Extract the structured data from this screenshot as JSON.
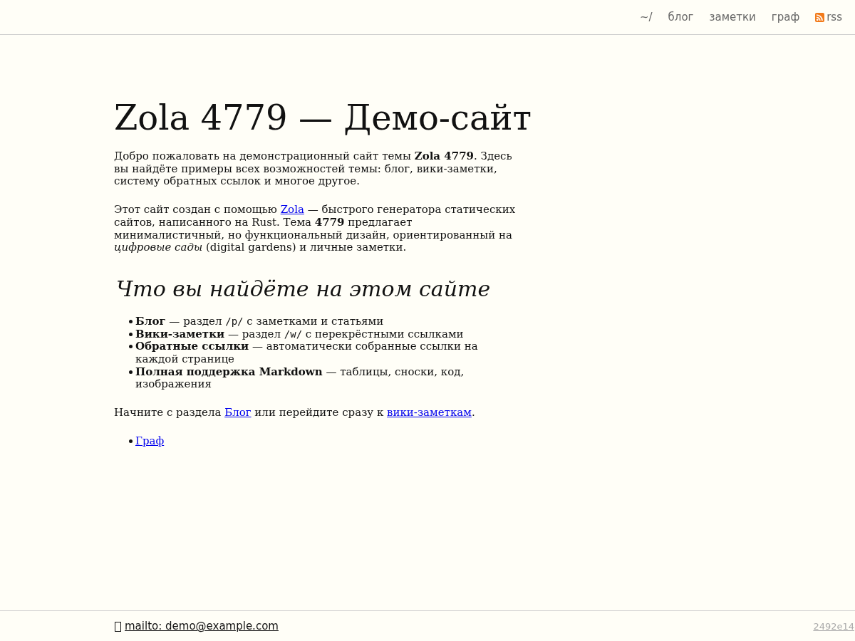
{
  "nav": [
    {
      "label": "~/",
      "kind": "page"
    },
    {
      "label": "блог",
      "kind": "page"
    },
    {
      "label": "заметки",
      "kind": "page"
    },
    {
      "label": "граф",
      "kind": "page"
    },
    {
      "label": "rss",
      "kind": "feed"
    }
  ],
  "title": "Zola 4779 — Демо-сайт",
  "content": [
    {
      "kind": "paragraph",
      "segments": [
        {
          "kind": "text",
          "text": "Добро пожаловать на демонстрационный сайт темы **Zola 4779**. Здесь вы найдёте примеры всех возможностей темы: блог, вики-заметки, систему обратных ссылок и многое другое."
        }
      ]
    },
    {
      "kind": "paragraph",
      "segments": [
        {
          "kind": "text",
          "text": "Этот сайт создан с помощью "
        },
        {
          "kind": "link",
          "text": "Zola"
        },
        {
          "kind": "text",
          "text": " — быстрого генератора статических сайтов, написанного на Rust. Тема **4779** предлагает минималистичный, но функциональный дизайн, ориентированный на *цифровые сады* (digital gardens) и личные заметки."
        }
      ]
    },
    {
      "kind": "heading",
      "text": "Что вы найдёте на этом сайте"
    },
    {
      "kind": "list",
      "items": [
        {
          "segments": [
            {
              "kind": "text",
              "text": "**Блог** — раздел "
            },
            {
              "kind": "code",
              "text": "/p/"
            },
            {
              "kind": "text",
              "text": " с заметками и статьями"
            }
          ]
        },
        {
          "segments": [
            {
              "kind": "text",
              "text": "**Вики-заметки** — раздел "
            },
            {
              "kind": "code",
              "text": "/w/"
            },
            {
              "kind": "text",
              "text": " с перекрёстными ссылками"
            }
          ]
        },
        {
          "segments": [
            {
              "kind": "text",
              "text": "**Обратные ссылки** — автоматически собранные ссылки на каждой странице"
            }
          ]
        },
        {
          "segments": [
            {
              "kind": "text",
              "text": "**Полная поддержка Markdown** — таблицы, сноски, код, изображения"
            }
          ]
        }
      ]
    },
    {
      "kind": "paragraph",
      "segments": [
        {
          "kind": "text",
          "text": "Начните с раздела "
        },
        {
          "kind": "link",
          "text": "Блог"
        },
        {
          "kind": "text",
          "text": " или перейдите сразу к "
        },
        {
          "kind": "link",
          "text": "вики-заметкам"
        },
        {
          "kind": "text",
          "text": "."
        }
      ]
    },
    {
      "kind": "list",
      "items": [
        {
          "segments": [
            {
              "kind": "link",
              "text": "Граф"
            }
          ]
        }
      ]
    }
  ],
  "footer": {
    "email": "mailto: demo@example.com",
    "version": "2492e14"
  }
}
